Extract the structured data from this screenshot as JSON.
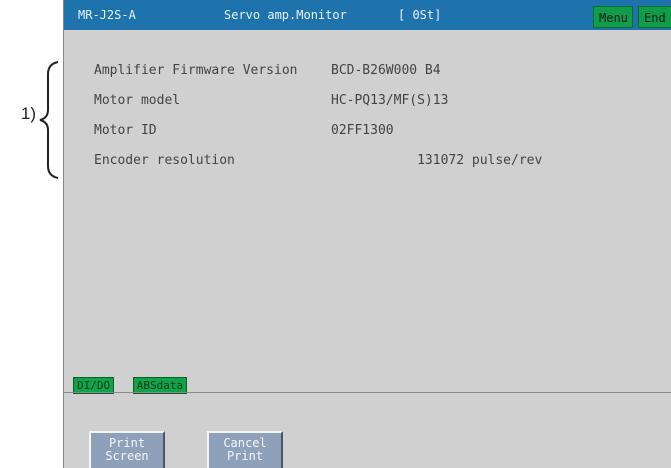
{
  "callout": {
    "label": "1)"
  },
  "titlebar": {
    "model": "MR-J2S-A",
    "screen": "Servo amp.Monitor",
    "state": "[ 0St]",
    "menu_label": "Menu",
    "end_label": "End"
  },
  "info": [
    {
      "label": "Amplifier Firmware Version",
      "value": "BCD-B26W000 B4"
    },
    {
      "label": "Motor model",
      "value": "HC-PQ13/MF(S)13"
    },
    {
      "label": "Motor ID",
      "value": "02FF1300"
    },
    {
      "label": "Encoder resolution",
      "value": "           131072 pulse/rev"
    }
  ],
  "tabs": [
    {
      "label": "DI/DO"
    },
    {
      "label": "ABSdata"
    }
  ],
  "buttons": {
    "print": {
      "line1": "Print",
      "line2": "Screen"
    },
    "cancel": {
      "line1": "Cancel",
      "line2": "Print"
    }
  },
  "colors": {
    "titlebar": "#1f73ad",
    "menu_button": "#0f9d4a",
    "tab": "#12a24a",
    "panel": "#d0d0d0",
    "soft_button": "#8fa0bb"
  }
}
